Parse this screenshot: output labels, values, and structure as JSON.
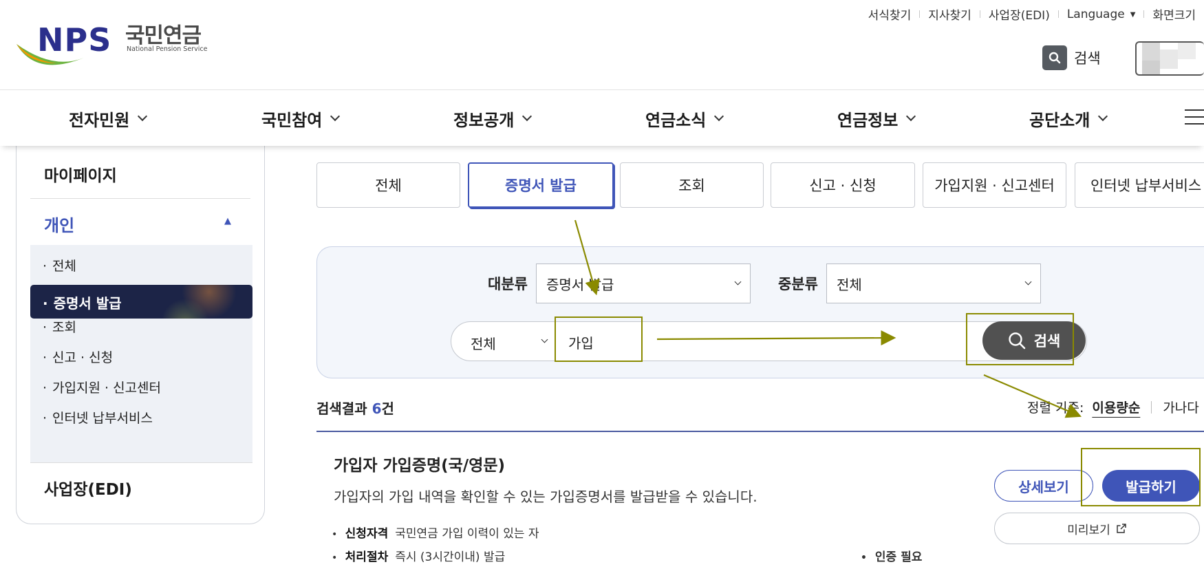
{
  "brand": {
    "logo_text": "NPS",
    "name_ko": "국민연금",
    "name_en": "National Pension Service",
    "colors": {
      "navy": "#2b2f8c",
      "green": "#6cb33f",
      "orange": "#f39800",
      "accent": "#3f55b8"
    }
  },
  "util_links": [
    "서식찾기",
    "지사찾기",
    "사업장(EDI)",
    "Language",
    "화면크기"
  ],
  "header_search_label": "검색",
  "gnb": [
    "전자민원",
    "국민참여",
    "정보공개",
    "연금소식",
    "연금정보",
    "공단소개"
  ],
  "sidebar": {
    "title": "마이페이지",
    "section": "개인",
    "items": [
      "전체",
      "증명서 발급",
      "조회",
      "신고 · 신청",
      "가입지원 · 신고센터",
      "인터넷 납부서비스"
    ],
    "active_index": 1,
    "footer": "사업장(EDI)"
  },
  "tabs": [
    "전체",
    "증명서 발급",
    "조회",
    "신고 · 신청",
    "가입지원 · 신고센터",
    "인터넷 납부서비스"
  ],
  "active_tab_index": 1,
  "filters": {
    "major_label": "대분류",
    "major_value": "증명서 발급",
    "minor_label": "중분류",
    "minor_value": "전체",
    "scope_value": "전체",
    "query": "가입",
    "search_button": "검색"
  },
  "results": {
    "prefix": "검색결과",
    "count": "6",
    "suffix": "건",
    "sort_label": "정렬 기준:",
    "sort_options": [
      "이용량순",
      "가나다"
    ]
  },
  "item": {
    "title": "가입자 가입증명(국/영문)",
    "desc": "가입자의 가입 내역을 확인할 수 있는 가입증명서를 발급받을 수 있습니다.",
    "qual_label": "신청자격",
    "qual_value": "국민연금 가입 이력이 있는 자",
    "proc_label": "처리절차",
    "proc_value": "즉시 (3시간이내) 발급",
    "auth": "인증 필요",
    "btn_detail": "상세보기",
    "btn_issue": "발급하기",
    "btn_preview": "미리보기"
  },
  "icons": {
    "search": "search-icon",
    "external": "external-link-icon",
    "menu": "hamburger-menu-icon"
  },
  "annotation_color": "#8a8a00"
}
